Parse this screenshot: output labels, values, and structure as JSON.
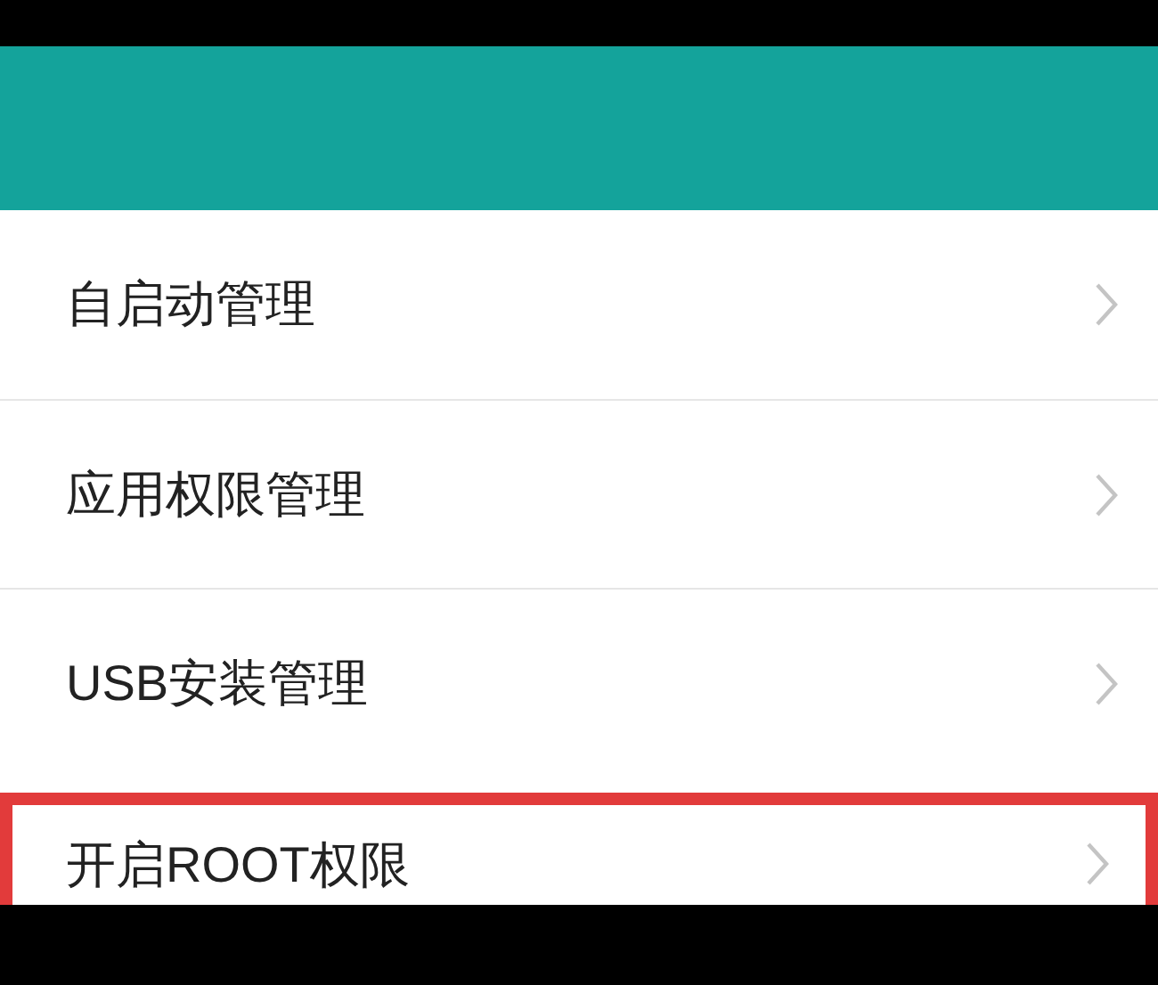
{
  "header": {
    "kind": "teal-bar"
  },
  "items": [
    {
      "label": "自启动管理",
      "highlighted": false
    },
    {
      "label": "应用权限管理",
      "highlighted": false
    },
    {
      "label": "USB安装管理",
      "highlighted": false
    },
    {
      "label": "开启ROOT权限",
      "highlighted": true
    }
  ]
}
